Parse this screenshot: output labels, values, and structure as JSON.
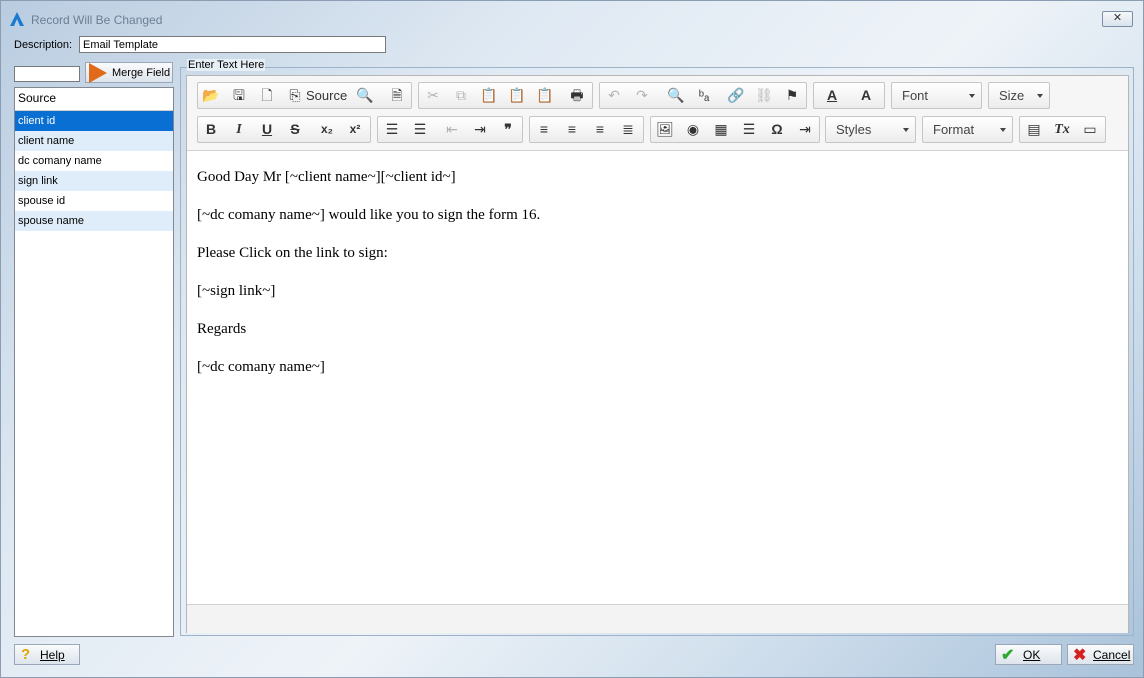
{
  "window": {
    "title": "Record Will Be Changed",
    "close_label": "✕"
  },
  "description": {
    "label": "Description:",
    "value": "Email Template"
  },
  "merge": {
    "input_value": "",
    "button_label": "Merge Field"
  },
  "source_list": {
    "header": "Source",
    "items": [
      "client id",
      "client name",
      "dc comany name",
      "sign link",
      "spouse id",
      "spouse name"
    ],
    "selected": "client id"
  },
  "editor": {
    "group_label": "Enter Text Here",
    "toolbar": {
      "source_label": "Source",
      "font_label": "Font",
      "size_label": "Size",
      "styles_label": "Styles",
      "format_label": "Format",
      "bold": "B",
      "italic": "I",
      "underline": "U",
      "strike": "S",
      "subscript": "x₂",
      "superscript": "x²",
      "blockquote": "❞",
      "omega": "Ω",
      "text_color": "A",
      "bg_color": "A",
      "clear_format": "Tx"
    },
    "content": [
      "Good Day Mr [~client name~][~client id~]",
      "[~dc comany name~] would like you to sign the form 16.",
      "Please Click on the link to sign:",
      "[~sign link~]",
      "Regards",
      "[~dc comany name~]"
    ]
  },
  "buttons": {
    "help": "Help",
    "ok": "OK",
    "cancel": "Cancel"
  },
  "colors": {
    "selected": "#0a6fd2",
    "alt_row": "#dfedfa",
    "merge_arrow": "#e06a1a",
    "ok_icon": "#2fa82f",
    "cancel_icon": "#d42020",
    "help_icon": "#e0a400"
  }
}
